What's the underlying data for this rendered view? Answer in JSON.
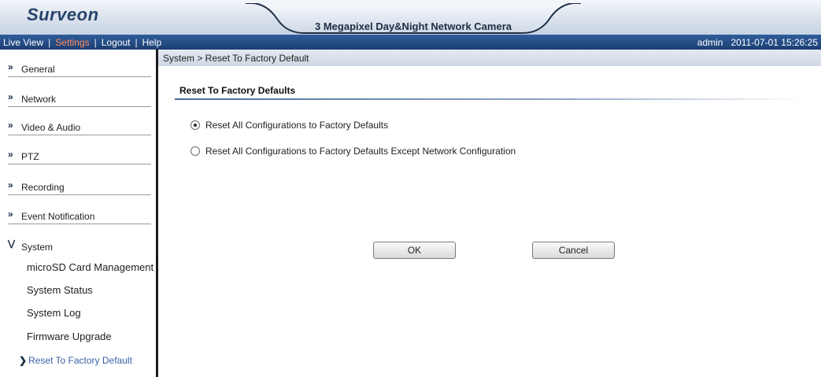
{
  "header": {
    "logo": "Surveon",
    "title": "3 Megapixel Day&Night Network Camera"
  },
  "menubar": {
    "items": [
      "Live View",
      "Settings",
      "Logout",
      "Help"
    ],
    "active": "Settings",
    "separator": "|",
    "user": "admin",
    "datetime": "2011-07-01 15:26:25"
  },
  "sidebar": {
    "sections": [
      {
        "label": "General"
      },
      {
        "label": "Network"
      },
      {
        "label": "Video & Audio"
      },
      {
        "label": "PTZ"
      },
      {
        "label": "Recording"
      },
      {
        "label": "Event Notification"
      },
      {
        "label": "System"
      }
    ],
    "system_items": [
      {
        "label": "microSD Card Management"
      },
      {
        "label": "System Status"
      },
      {
        "label": "System Log"
      },
      {
        "label": "Firmware Upgrade"
      },
      {
        "label": "Reset To Factory Default"
      }
    ],
    "icons": {
      "collapsed": "double-chevron-right-icon",
      "expanded": "double-chevron-down-icon",
      "current": "chevron-right-icon"
    }
  },
  "breadcrumb": "System > Reset To Factory Default",
  "main": {
    "section_title": "Reset To Factory Defaults",
    "options": [
      {
        "label": "Reset All Configurations to Factory Defaults",
        "checked": true
      },
      {
        "label": "Reset All Configurations to Factory Defaults Except Network Configuration",
        "checked": false
      }
    ],
    "ok_label": "OK",
    "cancel_label": "Cancel"
  }
}
